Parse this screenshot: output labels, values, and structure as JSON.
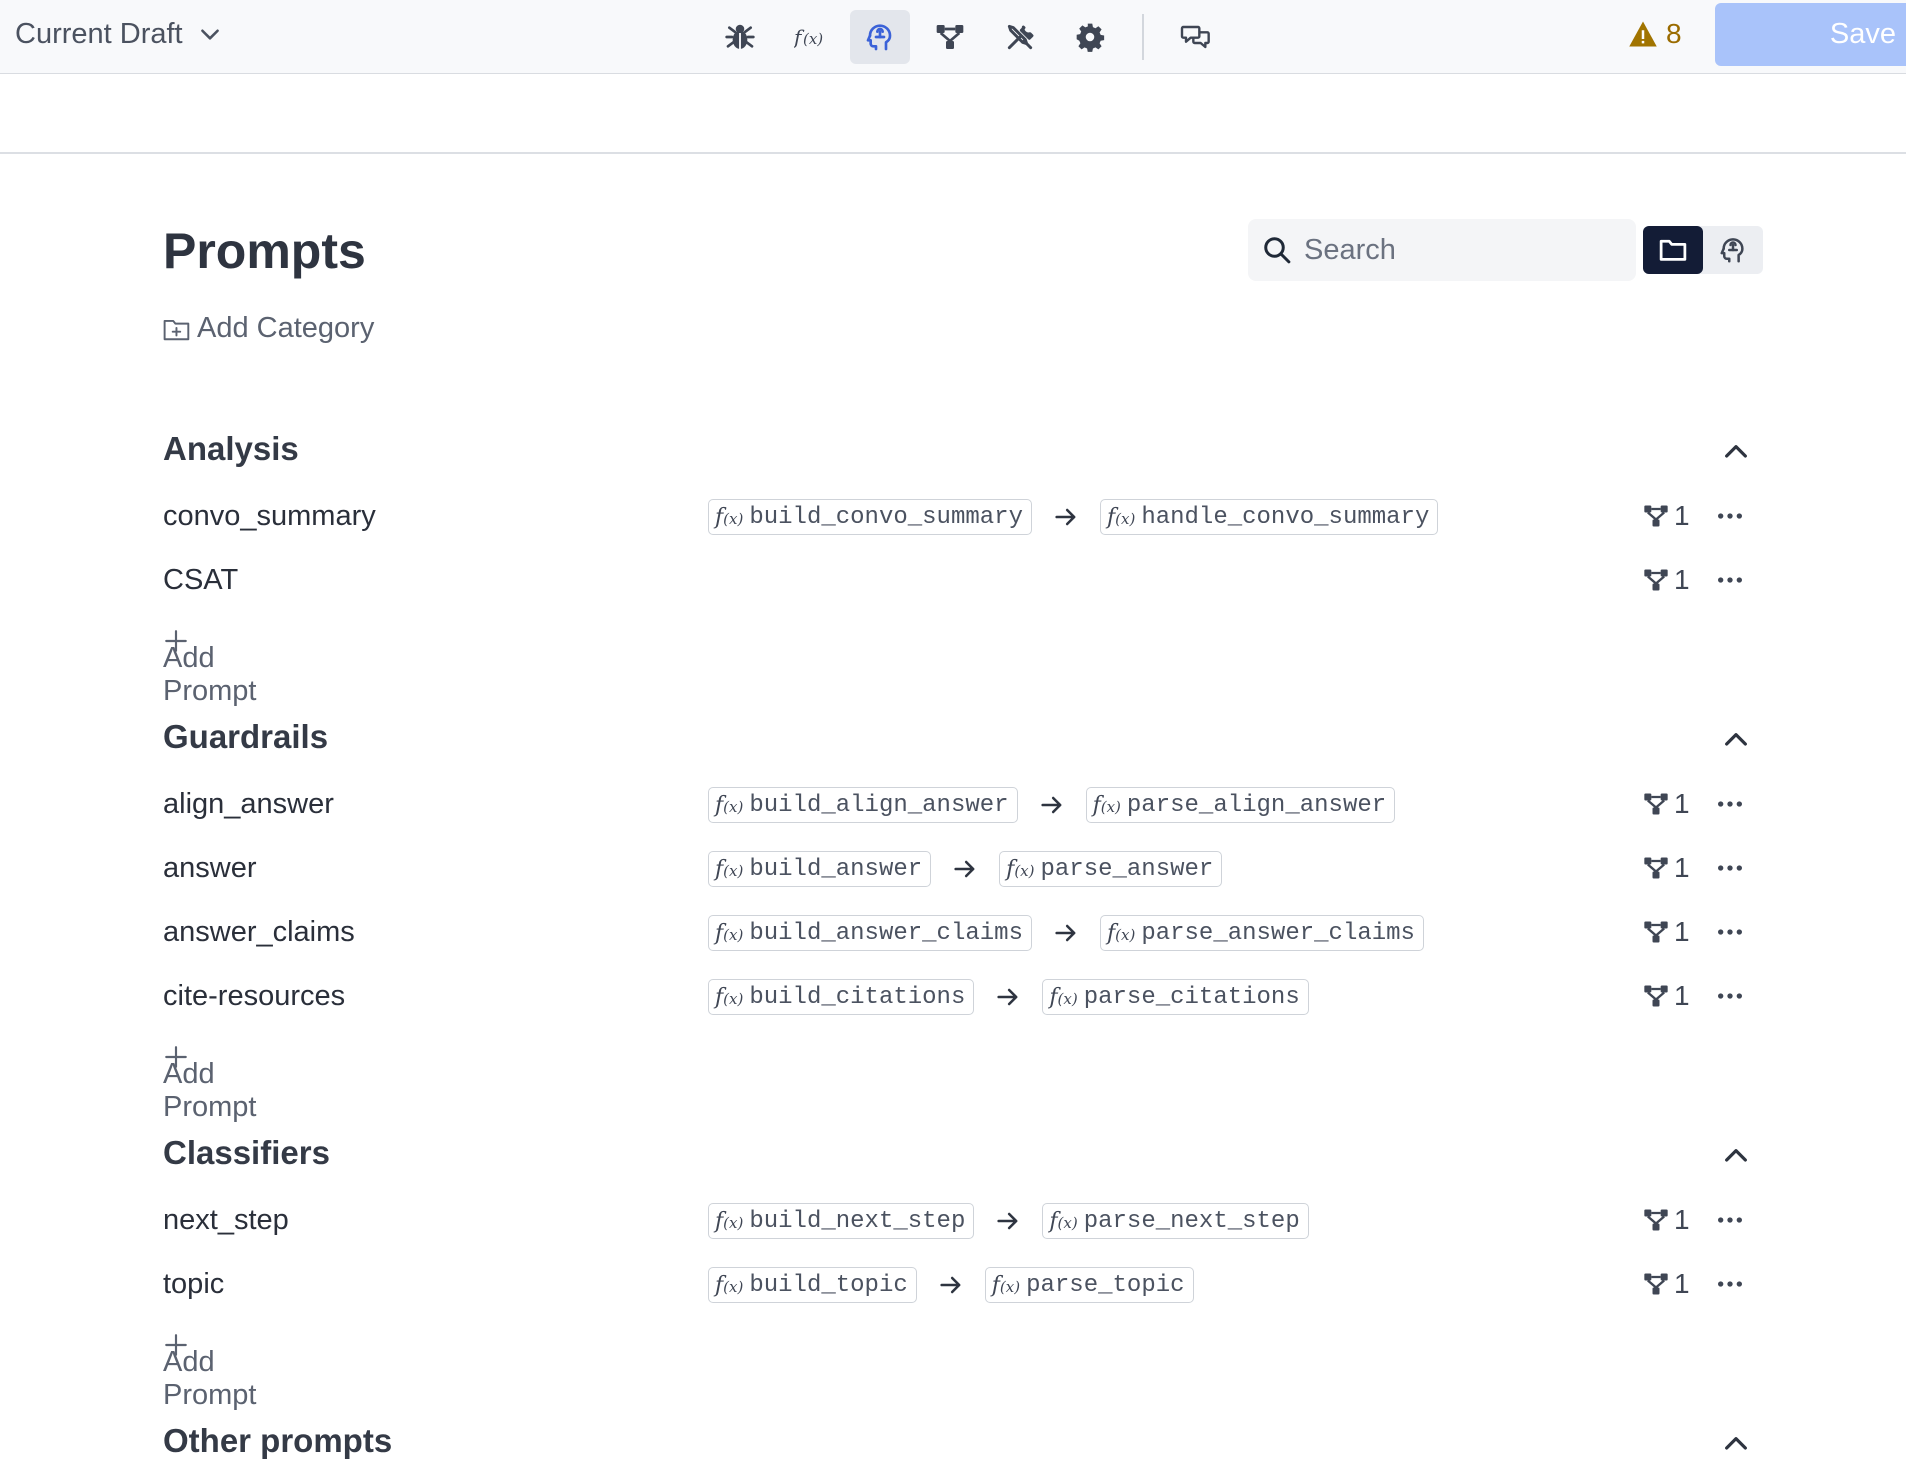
{
  "topbar": {
    "draft_label": "Current Draft",
    "tools": [
      {
        "icon": "bug-icon"
      },
      {
        "icon": "function-icon"
      },
      {
        "icon": "brain-icon",
        "active": true
      },
      {
        "icon": "flow-icon"
      },
      {
        "icon": "tools-icon"
      },
      {
        "icon": "gear-icon"
      }
    ],
    "chat_icon": "chat-icon",
    "warning_count": "8",
    "save_label": "Save"
  },
  "page": {
    "title": "Prompts",
    "add_category_label": "Add Category",
    "search_placeholder": "Search",
    "view_toggle": [
      {
        "icon": "folder-icon",
        "active": true
      },
      {
        "icon": "brain-icon",
        "active": false
      }
    ]
  },
  "categories": [
    {
      "name": "Analysis",
      "prompts": [
        {
          "name": "convo_summary",
          "builder": "build_convo_summary",
          "parser": "handle_convo_summary",
          "flows": "1"
        },
        {
          "name": "CSAT",
          "builder": "",
          "parser": "",
          "flows": "1"
        }
      ],
      "add_label": "Add Prompt"
    },
    {
      "name": "Guardrails",
      "prompts": [
        {
          "name": "align_answer",
          "builder": "build_align_answer",
          "parser": "parse_align_answer",
          "flows": "1"
        },
        {
          "name": "answer",
          "builder": "build_answer",
          "parser": "parse_answer",
          "flows": "1"
        },
        {
          "name": "answer_claims",
          "builder": "build_answer_claims",
          "parser": "parse_answer_claims",
          "flows": "1"
        },
        {
          "name": "cite-resources",
          "builder": "build_citations",
          "parser": "parse_citations",
          "flows": "1"
        }
      ],
      "add_label": "Add Prompt"
    },
    {
      "name": "Classifiers",
      "prompts": [
        {
          "name": "next_step",
          "builder": "build_next_step",
          "parser": "parse_next_step",
          "flows": "1"
        },
        {
          "name": "topic",
          "builder": "build_topic",
          "parser": "parse_topic",
          "flows": "1"
        }
      ],
      "add_label": "Add Prompt"
    },
    {
      "name": "Other prompts",
      "prompts": [],
      "add_label": ""
    }
  ]
}
